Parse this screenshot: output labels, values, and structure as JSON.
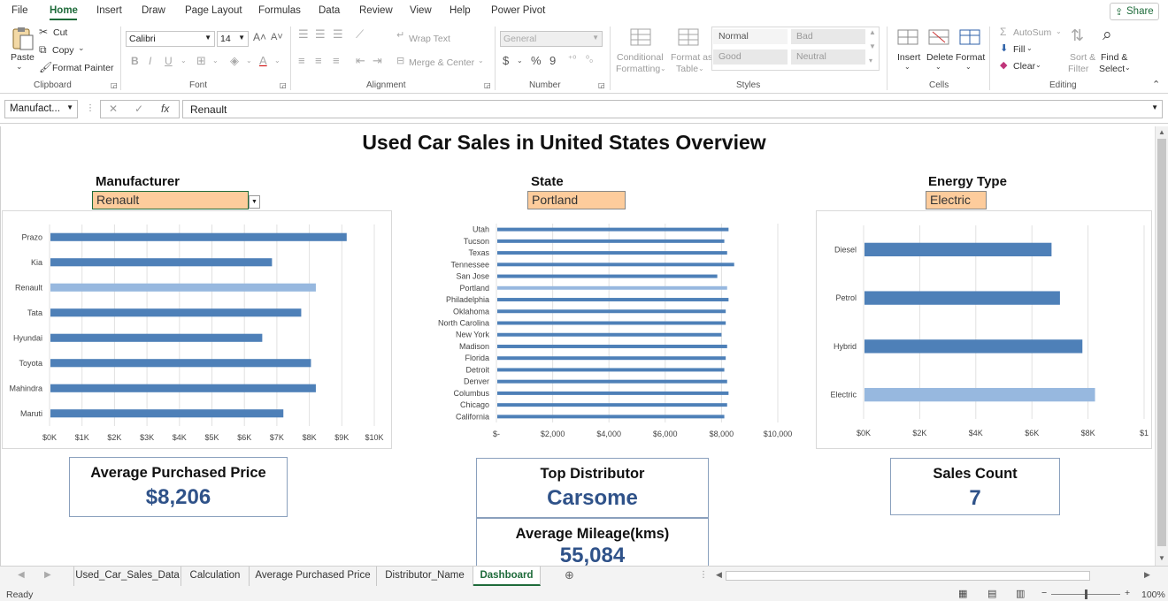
{
  "menu": [
    "File",
    "Home",
    "Insert",
    "Draw",
    "Page Layout",
    "Formulas",
    "Data",
    "Review",
    "View",
    "Help",
    "Power Pivot"
  ],
  "share": "Share",
  "ribbon": {
    "clipboard": {
      "paste": "Paste",
      "cut": "Cut",
      "copy": "Copy",
      "format_painter": "Format Painter",
      "group": "Clipboard"
    },
    "font": {
      "name": "Calibri",
      "size": "14",
      "group": "Font"
    },
    "alignment": {
      "wrap_text": "Wrap Text",
      "merge_center": "Merge & Center",
      "group": "Alignment"
    },
    "number": {
      "format": "General",
      "group": "Number"
    },
    "styles": {
      "conditional": "Conditional",
      "formatting": "Formatting",
      "format_as": "Format as",
      "table": "Table",
      "normal": "Normal",
      "bad": "Bad",
      "good": "Good",
      "neutral": "Neutral",
      "group": "Styles"
    },
    "cells": {
      "insert": "Insert",
      "delete": "Delete",
      "format": "Format",
      "group": "Cells"
    },
    "editing": {
      "autosum": "AutoSum",
      "fill": "Fill",
      "clear": "Clear",
      "sort": "Sort &",
      "filter": "Filter",
      "find": "Find &",
      "select": "Select",
      "group": "Editing"
    }
  },
  "formula_bar": {
    "name_box": "Manufact...",
    "value": "Renault"
  },
  "dashboard": {
    "title": "Used Car Sales in United States Overview",
    "slicers": {
      "manufacturer": {
        "label": "Manufacturer",
        "value": "Renault"
      },
      "state": {
        "label": "State",
        "value": "Portland"
      },
      "energy": {
        "label": "Energy Type",
        "value": "Electric"
      }
    },
    "kpis": {
      "avg_price": {
        "title": "Average Purchased Price",
        "value": "$8,206"
      },
      "top_distributor": {
        "title": "Top Distributor",
        "value": "Carsome"
      },
      "avg_mileage": {
        "title": "Average Mileage(kms)",
        "value": "55,084"
      },
      "sales_count": {
        "title": "Sales Count",
        "value": "7"
      }
    }
  },
  "colors": {
    "bar": "#4e80b8",
    "bar_selected": "#97b8df",
    "slicer": "#fdcc9c",
    "kpi_value": "#2f5289",
    "accent": "#1e6b3a"
  },
  "chart_data": [
    {
      "type": "bar",
      "orientation": "horizontal",
      "categories": [
        "Prazo",
        "Kia",
        "Renault",
        "Tata",
        "Hyundai",
        "Toyota",
        "Mahindra",
        "Maruti"
      ],
      "values": [
        9150,
        6850,
        8200,
        7750,
        6550,
        8050,
        8200,
        7200
      ],
      "selected": "Renault",
      "xlim": [
        0,
        10000
      ],
      "xticks": [
        "$0K",
        "$1K",
        "$2K",
        "$3K",
        "$4K",
        "$5K",
        "$6K",
        "$7K",
        "$8K",
        "$9K",
        "$10K"
      ],
      "grid": true
    },
    {
      "type": "bar",
      "orientation": "horizontal",
      "categories": [
        "Utah",
        "Tucson",
        "Texas",
        "Tennessee",
        "San Jose",
        "Portland",
        "Philadelphia",
        "Oklahoma",
        "North Carolina",
        "New York",
        "Madison",
        "Florida",
        "Detroit",
        "Denver",
        "Columbus",
        "Chicago",
        "California"
      ],
      "values": [
        8250,
        8100,
        8200,
        8450,
        7850,
        8200,
        8250,
        8150,
        8150,
        8000,
        8200,
        8150,
        8100,
        8200,
        8250,
        8200,
        8100
      ],
      "selected": "Portland",
      "xlim": [
        0,
        10000
      ],
      "xticks": [
        "$-",
        "$2,000",
        "$4,000",
        "$6,000",
        "$8,000",
        "$10,000"
      ],
      "grid": true
    },
    {
      "type": "bar",
      "orientation": "horizontal",
      "categories": [
        "Diesel",
        "Petrol",
        "Hybrid",
        "Electric"
      ],
      "values": [
        6700,
        7000,
        7800,
        8250
      ],
      "selected": "Electric",
      "xlim": [
        0,
        10000
      ],
      "xticks": [
        "$0K",
        "$2K",
        "$4K",
        "$6K",
        "$8K",
        "$1"
      ],
      "grid": true
    }
  ],
  "sheet_tabs": [
    "Used_Car_Sales_Data",
    "Calculation",
    "Average Purchased Price",
    "Distributor_Name",
    "Dashboard"
  ],
  "active_tab": "Dashboard",
  "status": {
    "ready": "Ready",
    "zoom": "100%"
  }
}
